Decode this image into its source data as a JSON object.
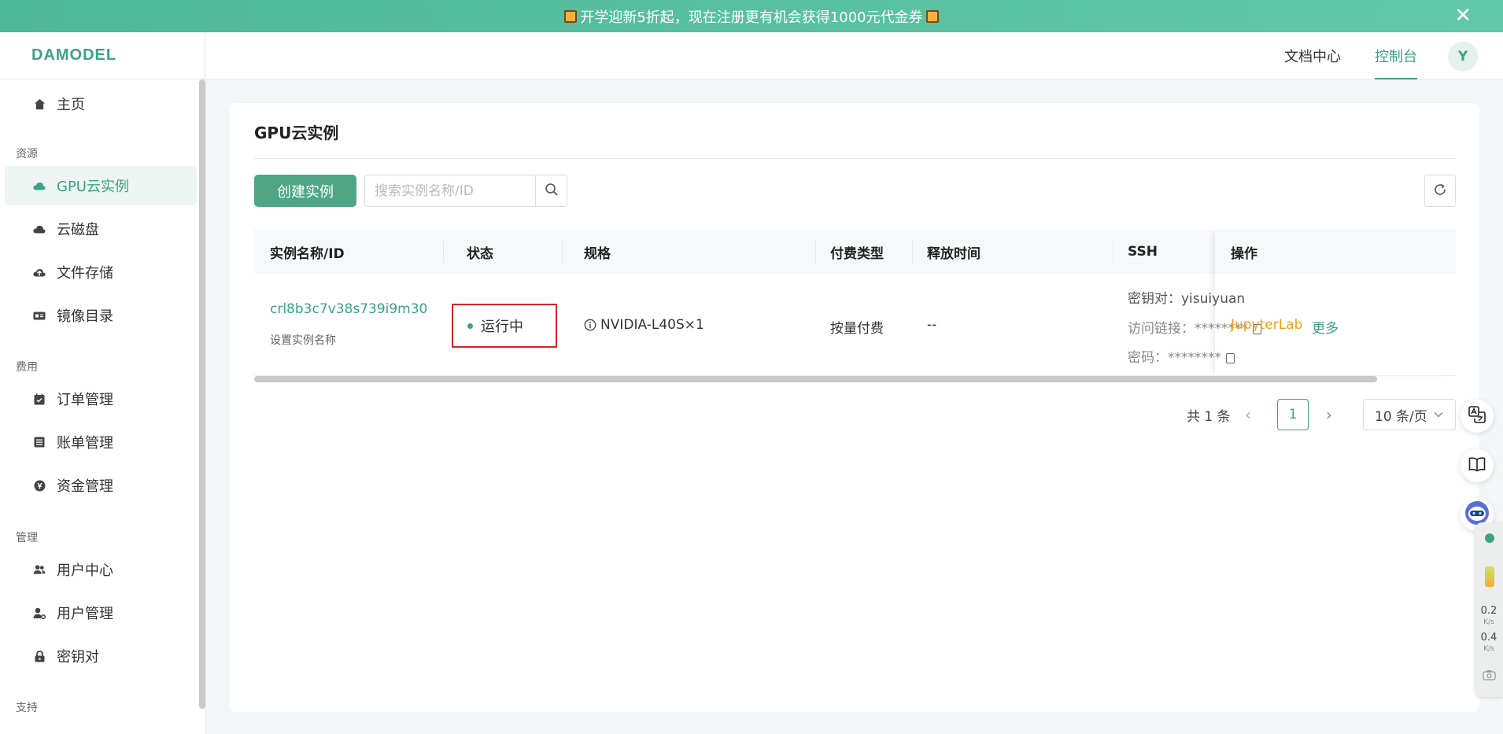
{
  "banner": {
    "text": "开学迎新5折起，现在注册更有机会获得1000元代金券",
    "close": "✕"
  },
  "header": {
    "logo": "DAMODEL",
    "nav_docs": "文档中心",
    "nav_console": "控制台",
    "avatar": "Y"
  },
  "sidebar": {
    "home": "主页",
    "section_resources": "资源",
    "gpu_instances": "GPU云实例",
    "cloud_disk": "云磁盘",
    "file_storage": "文件存储",
    "image_catalog": "镜像目录",
    "section_billing": "费用",
    "order_mgmt": "订单管理",
    "bill_mgmt": "账单管理",
    "fund_mgmt": "资金管理",
    "section_admin": "管理",
    "user_center": "用户中心",
    "user_mgmt": "用户管理",
    "key_pair": "密钥对",
    "section_support": "支持"
  },
  "main": {
    "title": "GPU云实例",
    "create_button": "创建实例",
    "search_placeholder": "搜索实例名称/ID",
    "columns": [
      "实例名称/ID",
      "状态",
      "规格",
      "付费类型",
      "释放时间",
      "SSH",
      "操作"
    ],
    "row": {
      "instance_id": "crl8b3c7v38s739i9m30",
      "set_name": "设置实例名称",
      "status": "运行中",
      "spec": "NVIDIA-L40S×1",
      "billing": "按量付费",
      "release_time": "--",
      "ssh_keypair": "密钥对：yisuiyuan",
      "ssh_link": "访问链接：********",
      "ssh_password": "密码：********",
      "action_jupyter": "JupyterLab",
      "action_more": "更多"
    },
    "pagination": {
      "total": "共 1 条",
      "current_page": "1",
      "page_size": "10 条/页"
    }
  },
  "monitor": {
    "upload_value": "0.2",
    "download_value": "0.4",
    "unit": "K/s"
  },
  "colors": {
    "brand": "#3aa384",
    "warning": "#f0a020",
    "highlight_border": "#d9232b"
  }
}
